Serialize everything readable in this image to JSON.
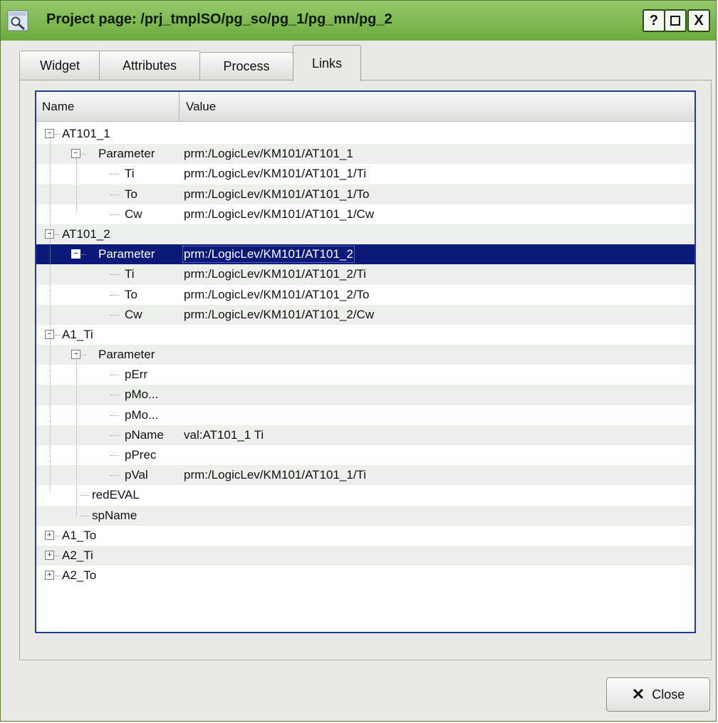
{
  "window": {
    "title": "Project page: /prj_tmplSO/pg_so/pg_1/pg_mn/pg_2",
    "app_icon": "magnifier-document-icon",
    "controls": {
      "help": "?",
      "maximize": "□",
      "close": "X"
    }
  },
  "tabs": [
    {
      "label": "Widget",
      "active": false
    },
    {
      "label": "Attributes",
      "active": false
    },
    {
      "label": "Process",
      "active": false
    },
    {
      "label": "Links",
      "active": true
    }
  ],
  "tree": {
    "columns": {
      "name": "Name",
      "value": "Value"
    },
    "rows": [
      {
        "name": "AT101_1",
        "value": "",
        "level": 0,
        "expander": "minus"
      },
      {
        "name": "Parameter",
        "value": "prm:/LogicLev/KM101/AT101_1",
        "level": 1,
        "expander": "minus"
      },
      {
        "name": "Ti",
        "value": "prm:/LogicLev/KM101/AT101_1/Ti",
        "level": 2,
        "expander": ""
      },
      {
        "name": "To",
        "value": "prm:/LogicLev/KM101/AT101_1/To",
        "level": 2,
        "expander": ""
      },
      {
        "name": "Cw",
        "value": "prm:/LogicLev/KM101/AT101_1/Cw",
        "level": 2,
        "expander": ""
      },
      {
        "name": "AT101_2",
        "value": "",
        "level": 0,
        "expander": "minus"
      },
      {
        "name": "Parameter",
        "value": "prm:/LogicLev/KM101/AT101_2",
        "level": 1,
        "expander": "minus",
        "selected": true
      },
      {
        "name": "Ti",
        "value": "prm:/LogicLev/KM101/AT101_2/Ti",
        "level": 2,
        "expander": ""
      },
      {
        "name": "To",
        "value": "prm:/LogicLev/KM101/AT101_2/To",
        "level": 2,
        "expander": ""
      },
      {
        "name": "Cw",
        "value": "prm:/LogicLev/KM101/AT101_2/Cw",
        "level": 2,
        "expander": ""
      },
      {
        "name": "A1_Ti",
        "value": "",
        "level": 0,
        "expander": "minus"
      },
      {
        "name": "Parameter",
        "value": "",
        "level": 1,
        "expander": "minus"
      },
      {
        "name": "pErr",
        "value": "",
        "level": 2,
        "expander": ""
      },
      {
        "name": "pMo...",
        "value": "",
        "level": 2,
        "expander": ""
      },
      {
        "name": "pMo...",
        "value": "",
        "level": 2,
        "expander": ""
      },
      {
        "name": "pName",
        "value": "val:AT101_1 Ti",
        "level": 2,
        "expander": ""
      },
      {
        "name": "pPrec",
        "value": "",
        "level": 2,
        "expander": ""
      },
      {
        "name": "pVal",
        "value": "prm:/LogicLev/KM101/AT101_1/Ti",
        "level": 2,
        "expander": ""
      },
      {
        "name": "redEVAL",
        "value": "",
        "level": 1,
        "expander": ""
      },
      {
        "name": "spName",
        "value": "",
        "level": 1,
        "expander": ""
      },
      {
        "name": "A1_To",
        "value": "",
        "level": 0,
        "expander": "plus"
      },
      {
        "name": "A2_Ti",
        "value": "",
        "level": 0,
        "expander": "plus"
      },
      {
        "name": "A2_To",
        "value": "",
        "level": 0,
        "expander": "plus"
      }
    ]
  },
  "footer": {
    "close_label": "Close",
    "close_icon": "x-mark-icon"
  }
}
